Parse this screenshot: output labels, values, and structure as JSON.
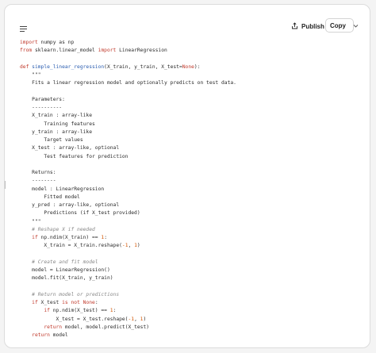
{
  "toolbar": {
    "publish_label": "Publish",
    "copy_label": "Copy"
  },
  "icons": {
    "menu": "menu-lines-icon",
    "publish": "share-upload-icon",
    "dropdown": "chevron-down-icon"
  },
  "colors": {
    "keyword": "#c0392b",
    "function_name": "#2a5db0",
    "number": "#d35400",
    "comment": "#888888"
  },
  "code_lines": [
    [
      {
        "t": "import",
        "c": "kw"
      },
      {
        "t": " numpy as np"
      }
    ],
    [
      {
        "t": "from",
        "c": "kw"
      },
      {
        "t": " sklearn.linear_model "
      },
      {
        "t": "import",
        "c": "kw"
      },
      {
        "t": " LinearRegression"
      }
    ],
    [],
    [
      {
        "t": "def",
        "c": "kw"
      },
      {
        "t": " "
      },
      {
        "t": "simple_linear_regression",
        "c": "fn"
      },
      {
        "t": "(X_train, y_train, X_test="
      },
      {
        "t": "None",
        "c": "kw"
      },
      {
        "t": "):"
      }
    ],
    [
      {
        "t": "    \"\"\""
      }
    ],
    [
      {
        "t": "    Fits a linear regression model and optionally predicts on test data."
      }
    ],
    [],
    [
      {
        "t": "    Parameters:"
      }
    ],
    [
      {
        "t": "    ----------"
      }
    ],
    [
      {
        "t": "    X_train : array-like"
      }
    ],
    [
      {
        "t": "        Training features"
      }
    ],
    [
      {
        "t": "    y_train : array-like"
      }
    ],
    [
      {
        "t": "        Target values"
      }
    ],
    [
      {
        "t": "    X_test : array-like, optional"
      }
    ],
    [
      {
        "t": "        Test features for prediction"
      }
    ],
    [],
    [
      {
        "t": "    Returns:"
      }
    ],
    [
      {
        "t": "    --------"
      }
    ],
    [
      {
        "t": "    model : LinearRegression"
      }
    ],
    [
      {
        "t": "        Fitted model"
      }
    ],
    [
      {
        "t": "    y_pred : array-like, optional"
      }
    ],
    [
      {
        "t": "        Predictions (if X_test provided)"
      }
    ],
    [
      {
        "t": "    \"\"\""
      }
    ],
    [
      {
        "t": "    "
      },
      {
        "t": "# Reshape X if needed",
        "c": "cm"
      }
    ],
    [
      {
        "t": "    "
      },
      {
        "t": "if",
        "c": "kw"
      },
      {
        "t": " np.ndim(X_train) == "
      },
      {
        "t": "1",
        "c": "num"
      },
      {
        "t": ":"
      }
    ],
    [
      {
        "t": "        X_train = X_train.reshape("
      },
      {
        "t": "-1",
        "c": "num"
      },
      {
        "t": ", "
      },
      {
        "t": "1",
        "c": "num"
      },
      {
        "t": ")"
      }
    ],
    [],
    [
      {
        "t": "    "
      },
      {
        "t": "# Create and fit model",
        "c": "cm"
      }
    ],
    [
      {
        "t": "    model = LinearRegression()"
      }
    ],
    [
      {
        "t": "    model.fit(X_train, y_train)"
      }
    ],
    [],
    [
      {
        "t": "    "
      },
      {
        "t": "# Return model or predictions",
        "c": "cm"
      }
    ],
    [
      {
        "t": "    "
      },
      {
        "t": "if",
        "c": "kw"
      },
      {
        "t": " X_test "
      },
      {
        "t": "is not",
        "c": "kw"
      },
      {
        "t": " "
      },
      {
        "t": "None",
        "c": "kw"
      },
      {
        "t": ":"
      }
    ],
    [
      {
        "t": "        "
      },
      {
        "t": "if",
        "c": "kw"
      },
      {
        "t": " np.ndim(X_test) == "
      },
      {
        "t": "1",
        "c": "num"
      },
      {
        "t": ":"
      }
    ],
    [
      {
        "t": "            X_test = X_test.reshape("
      },
      {
        "t": "-1",
        "c": "num"
      },
      {
        "t": ", "
      },
      {
        "t": "1",
        "c": "num"
      },
      {
        "t": ")"
      }
    ],
    [
      {
        "t": "        "
      },
      {
        "t": "return",
        "c": "kw"
      },
      {
        "t": " model, model.predict(X_test)"
      }
    ],
    [
      {
        "t": "    "
      },
      {
        "t": "return",
        "c": "kw"
      },
      {
        "t": " model"
      }
    ]
  ]
}
